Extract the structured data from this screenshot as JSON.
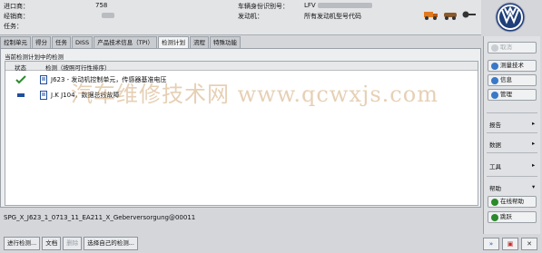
{
  "header": {
    "dealer_label": "进口商：",
    "dealer_value": "758",
    "workshop_label": "经销商：",
    "order_label": "任务：",
    "vin_label": "车辆身份识别号：",
    "vin_value": "LFV",
    "engine_label": "发动机：",
    "engine_value": "所有发动机型号代码"
  },
  "tabs": [
    {
      "label": "控制单元"
    },
    {
      "label": "得分"
    },
    {
      "label": "任务"
    },
    {
      "label": "DISS"
    },
    {
      "label": "产品技术信息（TPI）"
    },
    {
      "label": "检测计划"
    },
    {
      "label": "流程"
    },
    {
      "label": "特殊功能"
    }
  ],
  "plan": {
    "title": "当前检测计划中的检测",
    "col_status": "状态",
    "col_test": "检测（按照可行性排序）",
    "rows": [
      {
        "status": "done",
        "text": "J623 - 发动机控制单元，传感器基准电压"
      },
      {
        "status": "pending",
        "text": "J.K  J104，数据总线故障"
      }
    ]
  },
  "watermark": "汽车维修技术网   www.qcwxjs.com",
  "status_text": "SPG_X_J623_1_0713_11_EA211_X_Geberversorgung@00011",
  "bottom_buttons": [
    "进行检测...",
    "文档",
    "删除",
    "选择自己的检测..."
  ],
  "side_panel": {
    "btn_delete": "取消",
    "btn_measure": "测量技术",
    "btn_info": "信息",
    "btn_manage": "管理",
    "section_report": "报告",
    "section_data": "数据",
    "section_tools": "工具",
    "section_help": "帮助",
    "btn_online_help": "在线帮助",
    "btn_jump": "跳跃"
  },
  "colors": {
    "check": "#2b8a2b",
    "accent_blue": "#1f4e9c",
    "watermark": "#d2aa78"
  }
}
